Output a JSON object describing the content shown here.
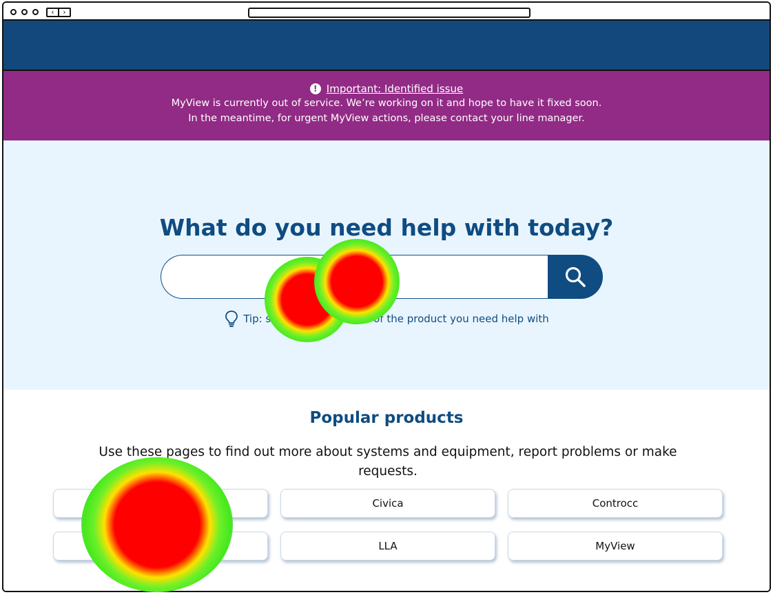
{
  "alert": {
    "icon": "exclamation-circle-icon",
    "title": "Important: Identified issue",
    "line1": "MyView is currently out of service. We’re working on it and hope to have it fixed soon.",
    "line2": "In the meantime, for urgent MyView actions, please contact your line manager."
  },
  "hero": {
    "title": "What do you need help with today?",
    "search_placeholder": "",
    "search_icon": "search-icon",
    "tip_icon": "lightbulb-icon",
    "tip_text": "Tip: search for the name of the product you need help with"
  },
  "popular": {
    "title": "Popular products",
    "description": "Use these pages to find out more about systems and equipment, report problems or make requests.",
    "products": [
      "",
      "Civica",
      "Controcc",
      "",
      "LLA",
      "MyView"
    ]
  },
  "colors": {
    "nav": "#13487c",
    "alert": "#922b85",
    "hero_bg": "#e9f5fe",
    "primary": "#0f4c81"
  }
}
